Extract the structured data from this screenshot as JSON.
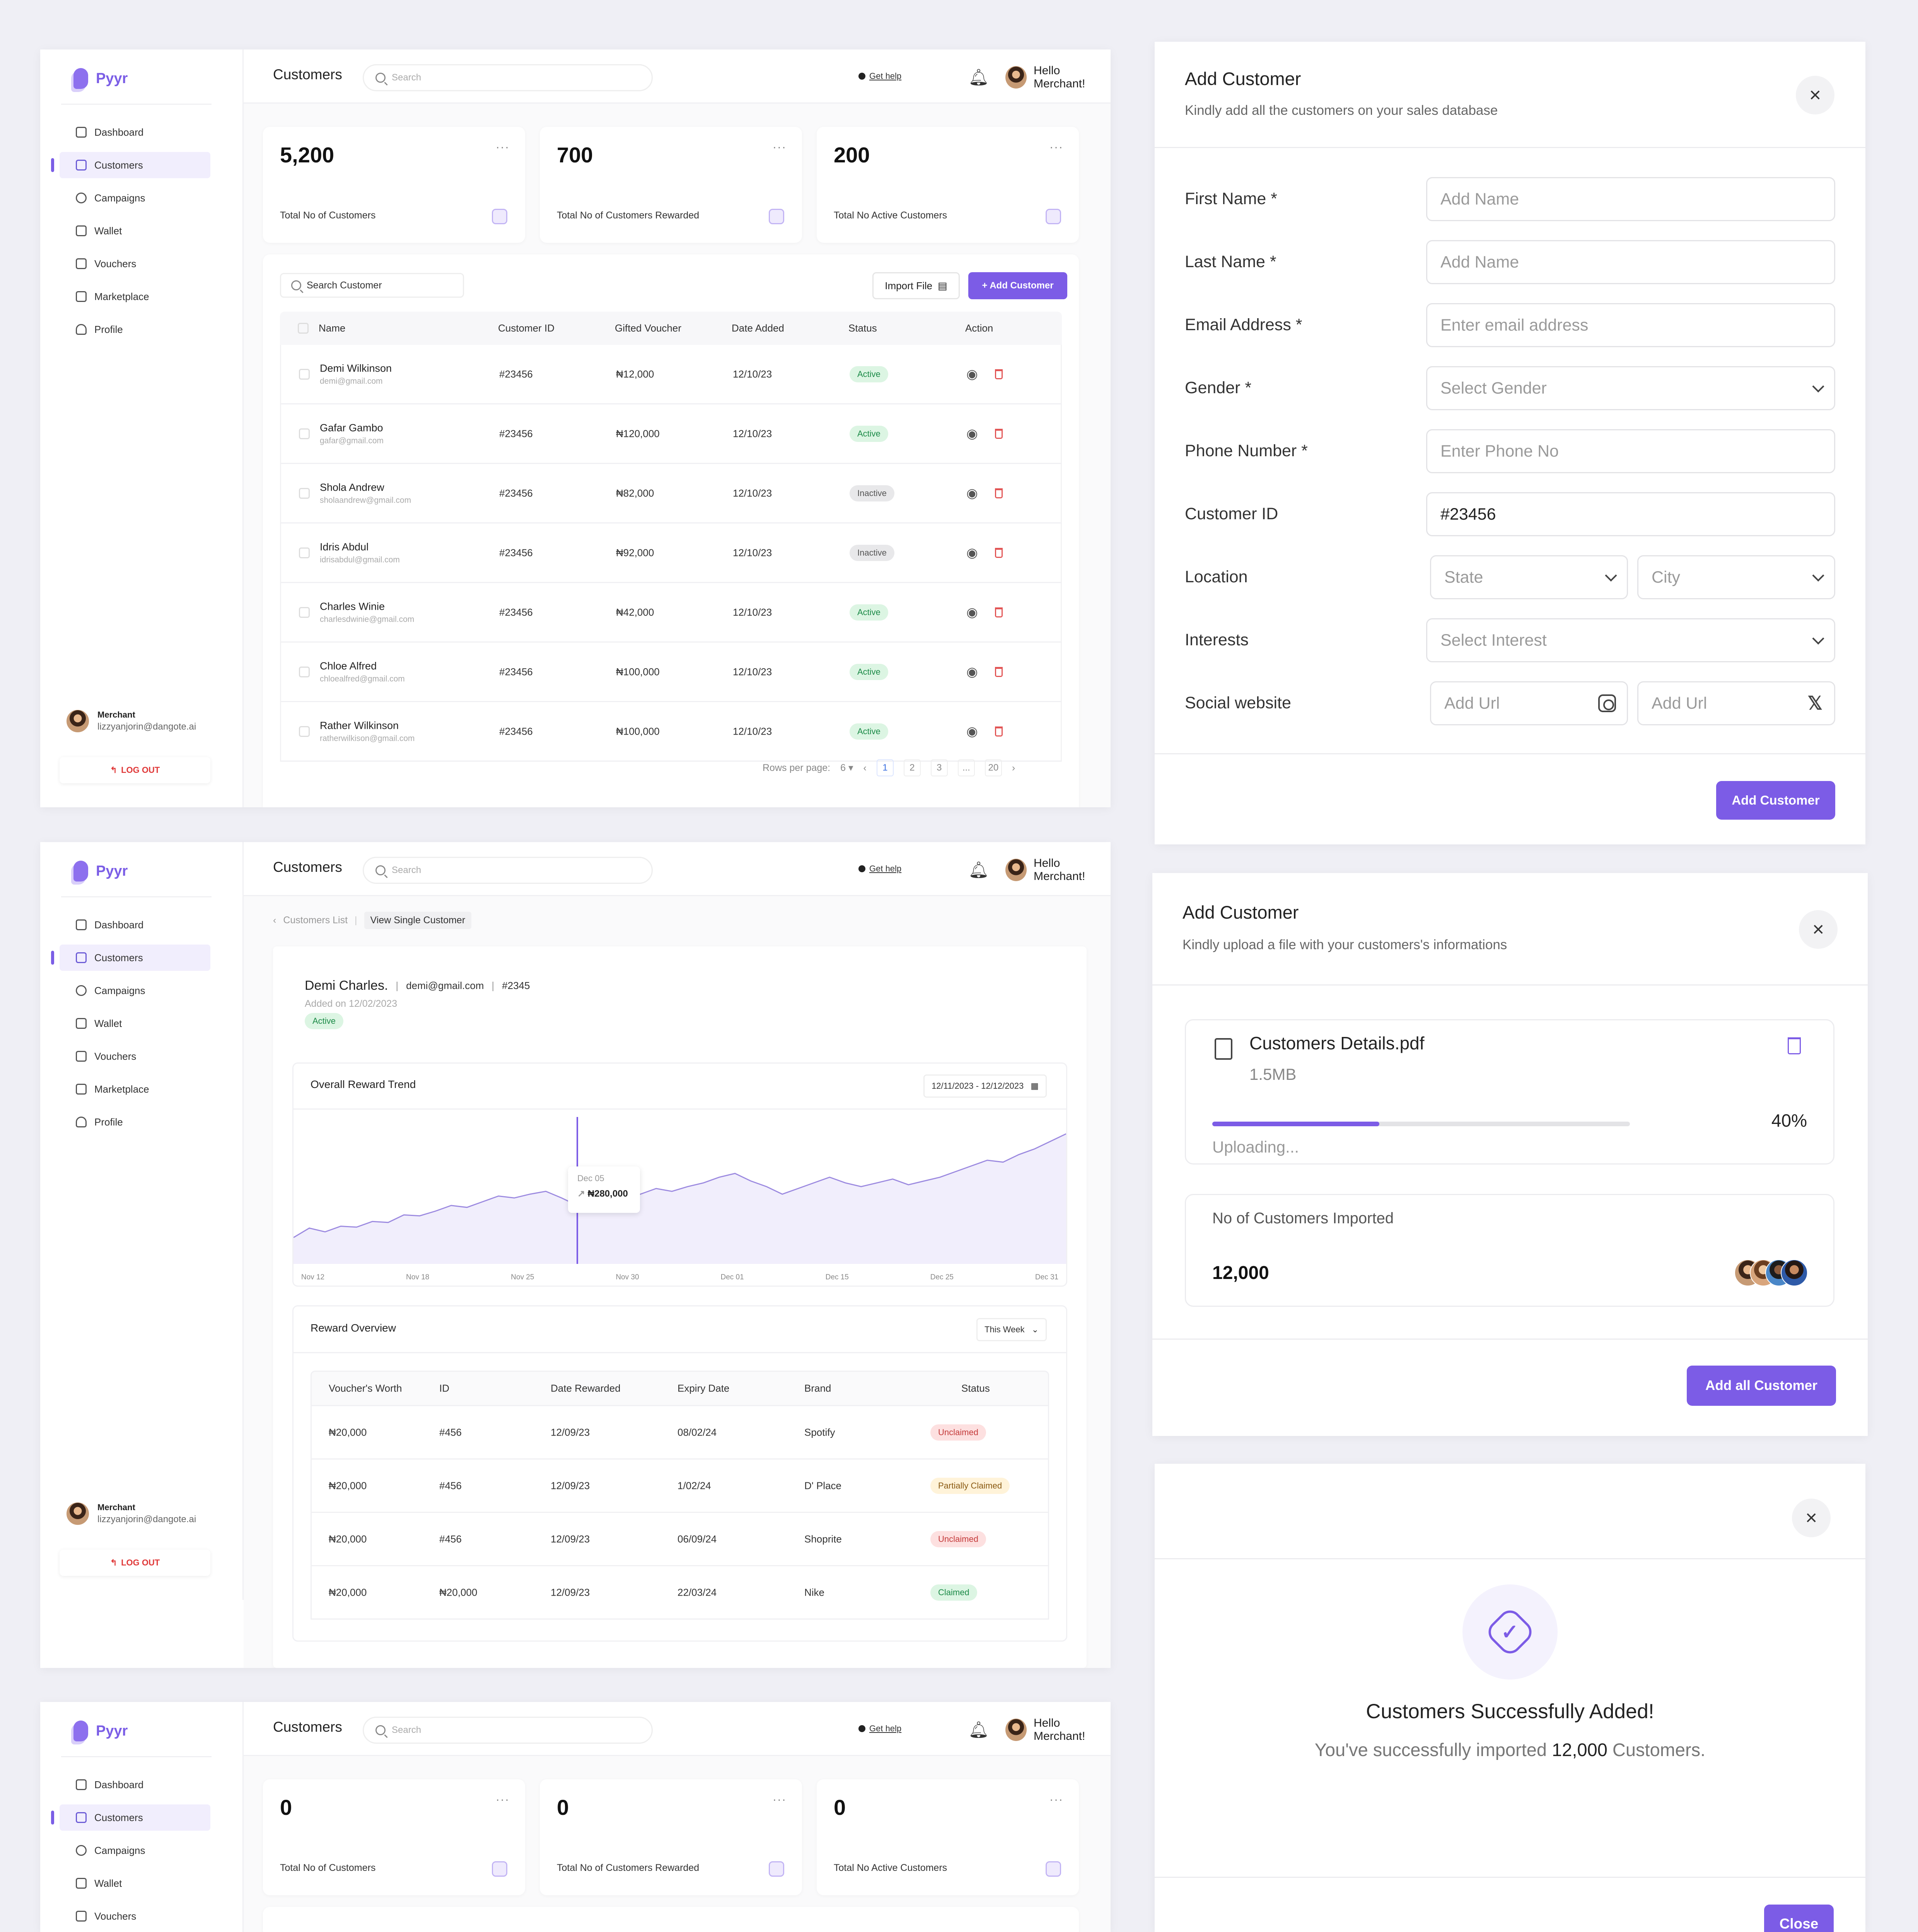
{
  "app": {
    "brand": "Pyyr",
    "page_title": "Customers",
    "search_placeholder": "Search",
    "get_help": "Get help",
    "greeting": "Hello Merchant!",
    "menu": [
      {
        "label": "Dashboard",
        "icon": "grid-icon"
      },
      {
        "label": "Customers",
        "icon": "users-icon"
      },
      {
        "label": "Campaigns",
        "icon": "campaign-icon"
      },
      {
        "label": "Wallet",
        "icon": "wallet-icon"
      },
      {
        "label": "Vouchers",
        "icon": "voucher-icon"
      },
      {
        "label": "Marketplace",
        "icon": "shop-icon"
      },
      {
        "label": "Profile",
        "icon": "user-icon"
      }
    ],
    "merchant_role": "Merchant",
    "merchant_email": "lizzyanjorin@dangote.ai",
    "logout": "LOG OUT"
  },
  "screen1": {
    "stats": [
      {
        "value": "5,200",
        "label": "Total No of Customers"
      },
      {
        "value": "700",
        "label": "Total No of Customers Rewarded"
      },
      {
        "value": "200",
        "label": "Total No Active Customers"
      }
    ],
    "table_search": "Search Customer",
    "import_file": "Import File",
    "add_customer": "+ Add Customer",
    "columns": [
      "Name",
      "Customer ID",
      "Gifted Voucher",
      "Date Added",
      "Status",
      "Action"
    ],
    "rows": [
      {
        "name": "Demi Wilkinson",
        "email": "demi@gmail.com",
        "id": "#23456",
        "voucher": "₦12,000",
        "date": "12/10/23",
        "status": "Active"
      },
      {
        "name": "Gafar Gambo",
        "email": "gafar@gmail.com",
        "id": "#23456",
        "voucher": "₦120,000",
        "date": "12/10/23",
        "status": "Active"
      },
      {
        "name": "Shola Andrew",
        "email": "sholaandrew@gmail.com",
        "id": "#23456",
        "voucher": "₦82,000",
        "date": "12/10/23",
        "status": "Inactive"
      },
      {
        "name": "Idris Abdul",
        "email": "idrisabdul@gmail.com",
        "id": "#23456",
        "voucher": "₦92,000",
        "date": "12/10/23",
        "status": "Inactive"
      },
      {
        "name": "Charles Winie",
        "email": "charlesdwinie@gmail.com",
        "id": "#23456",
        "voucher": "₦42,000",
        "date": "12/10/23",
        "status": "Active"
      },
      {
        "name": "Chloe Alfred",
        "email": "chloealfred@gmail.com",
        "id": "#23456",
        "voucher": "₦100,000",
        "date": "12/10/23",
        "status": "Active"
      },
      {
        "name": "Rather Wilkinson",
        "email": "ratherwilkison@gmail.com",
        "id": "#23456",
        "voucher": "₦100,000",
        "date": "12/10/23",
        "status": "Active"
      }
    ],
    "rows_per_page_label": "Rows per page:",
    "rows_per_page": "6",
    "pages": [
      "1",
      "2",
      "3",
      "...",
      "20"
    ]
  },
  "screen2": {
    "breadcrumb_back": "Customers List",
    "breadcrumb_current": "View Single Customer",
    "customer_name": "Demi Charles.",
    "customer_email": "demi@gmail.com",
    "customer_id": "#2345",
    "added_on": "Added on 12/02/2023",
    "status": "Active",
    "trend_title": "Overall Reward Trend",
    "date_range": "12/11/2023 - 12/12/2023",
    "tooltip_date": "Dec 05",
    "tooltip_value": "₦280,000",
    "overview_title": "Reward Overview",
    "period": "This Week",
    "columns": [
      "Voucher's Worth",
      "ID",
      "Date Rewarded",
      "Expiry Date",
      "Brand",
      "Status"
    ],
    "rows": [
      {
        "worth": "₦20,000",
        "id": "#456",
        "rewarded": "12/09/23",
        "expiry": "08/02/24",
        "brand": "Spotify",
        "status": "Unclaimed"
      },
      {
        "worth": "₦20,000",
        "id": "#456",
        "rewarded": "12/09/23",
        "expiry": "1/02/24",
        "brand": "D' Place",
        "status": "Partially Claimed"
      },
      {
        "worth": "₦20,000",
        "id": "#456",
        "rewarded": "12/09/23",
        "expiry": "06/09/24",
        "brand": "Shoprite",
        "status": "Unclaimed"
      },
      {
        "worth": "₦20,000",
        "id": "₦20,000",
        "rewarded": "12/09/23",
        "expiry": "22/03/24",
        "brand": "Nike",
        "status": "Claimed"
      }
    ]
  },
  "chart_data": {
    "type": "area",
    "x": [
      "Nov 12",
      "Nov 18",
      "Nov 25",
      "Nov 30",
      "Dec 01",
      "Dec 15",
      "Dec 25",
      "Dec 31"
    ],
    "series": [
      {
        "values": [
          0.28,
          0.38,
          0.34,
          0.4,
          0.39,
          0.45,
          0.44,
          0.52,
          0.51,
          0.56,
          0.62,
          0.6,
          0.66,
          0.72,
          0.7,
          0.74,
          0.77,
          0.7,
          0.62,
          0.55,
          0.58,
          0.68,
          0.74,
          0.8,
          0.77,
          0.82,
          0.86,
          0.92,
          0.96,
          0.88,
          0.82,
          0.74,
          0.8,
          0.86,
          0.92,
          0.86,
          0.82,
          0.86,
          0.9,
          0.84,
          0.88,
          0.92,
          0.98,
          1.04,
          1.1,
          1.08,
          1.16,
          1.22,
          1.3,
          1.38
        ]
      }
    ],
    "tooltip": {
      "x": "Dec 05",
      "y": "₦280,000"
    }
  },
  "screen3": {
    "stats": [
      {
        "value": "0",
        "label": "Total No of Customers"
      },
      {
        "value": "0",
        "label": "Total No of Customers Rewarded"
      },
      {
        "value": "0",
        "label": "Total No Active Customers"
      }
    ]
  },
  "modal_add": {
    "title": "Add Customer",
    "subtitle": "Kindly add all the customers on your sales database",
    "fields": [
      {
        "label": "First Name *",
        "placeholder": "Add Name"
      },
      {
        "label": "Last Name *",
        "placeholder": "Add Name"
      },
      {
        "label": "Email Address *",
        "placeholder": "Enter email address"
      },
      {
        "label": "Gender *",
        "placeholder": "Select Gender"
      },
      {
        "label": "Phone Number *",
        "placeholder": "Enter Phone No"
      },
      {
        "label": "Customer ID",
        "value": "#23456"
      },
      {
        "label": "Location",
        "state": "State",
        "city": "City"
      },
      {
        "label": "Interests",
        "placeholder": "Select Interest"
      },
      {
        "label": "Social website",
        "url1": "Add Url",
        "url2": "Add Url"
      }
    ],
    "submit": "Add Customer"
  },
  "modal_upload": {
    "title": "Add Customer",
    "subtitle": "Kindly upload a file with your customers's informations",
    "file_name": "Customers Details.pdf",
    "file_size": "1.5MB",
    "progress": 0.4,
    "progress_label": "40%",
    "status": "Uploading...",
    "imported_label": "No of Customers Imported",
    "imported_count": "12,000",
    "submit": "Add all Customer"
  },
  "modal_success": {
    "title": "Customers Successfully Added!",
    "msg_prefix": "You've successfully imported ",
    "msg_count": "12,000",
    "msg_suffix": " Customers.",
    "close": "Close"
  }
}
